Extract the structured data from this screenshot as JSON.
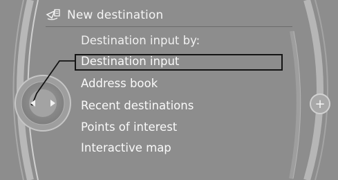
{
  "window": {
    "title": "New destination",
    "title_icon": "navigation-destination-icon"
  },
  "menu": {
    "prompt": "Destination input by:",
    "selected_index": 0,
    "items": [
      {
        "label": "Destination input"
      },
      {
        "label": "Address book"
      },
      {
        "label": "Recent destinations"
      },
      {
        "label": "Points of interest"
      },
      {
        "label": "Interactive map"
      }
    ]
  },
  "controller": {
    "left_arrow_icon": "arrow-left-icon",
    "right_arrow_icon": "arrow-right-icon"
  },
  "side_button": {
    "icon": "plus-icon",
    "symbol": "+"
  },
  "colors": {
    "background": "#8d8d8d",
    "text": "#f4f4f4",
    "selection_border": "#141414"
  }
}
